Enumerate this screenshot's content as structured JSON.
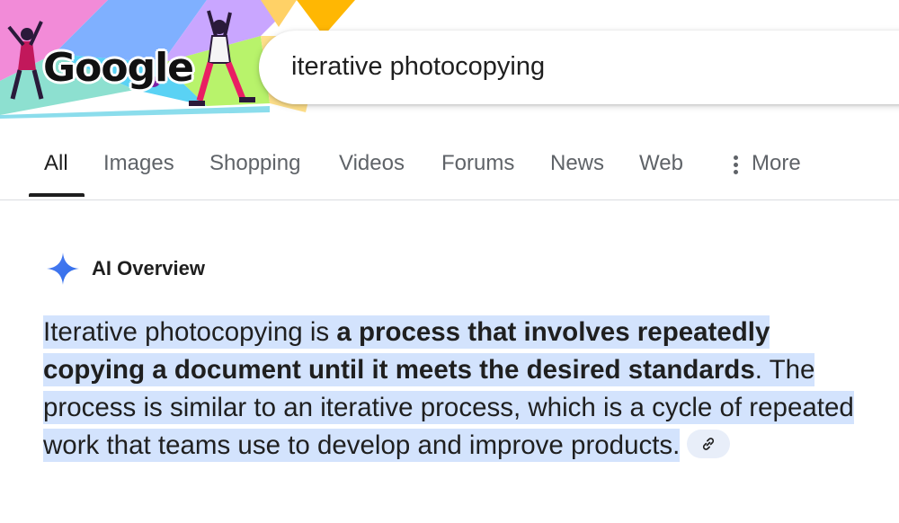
{
  "header": {
    "logo_text": "Google",
    "search_query": "iterative photocopying"
  },
  "tabs": [
    {
      "label": "All",
      "active": true
    },
    {
      "label": "Images",
      "active": false
    },
    {
      "label": "Shopping",
      "active": false
    },
    {
      "label": "Videos",
      "active": false
    },
    {
      "label": "Forums",
      "active": false
    },
    {
      "label": "News",
      "active": false
    },
    {
      "label": "Web",
      "active": false
    },
    {
      "label": "More",
      "active": false,
      "icon": "more-vert-icon"
    }
  ],
  "ai_overview": {
    "title": "AI Overview",
    "icon": "sparkle-icon",
    "answer_intro": "Iterative photocopying is ",
    "answer_bold": "a process that involves repeatedly copying a document until it meets the desired standards",
    "answer_rest": ". The process is similar to an iterative process, which is a cycle of repeated work that teams use to develop and improve products.",
    "link_icon": "link-icon"
  },
  "colors": {
    "accent_blue": "#4285f4",
    "highlight": "#d3e3fd",
    "text": "#1f1f1f",
    "tab_inactive": "#5f6368"
  }
}
